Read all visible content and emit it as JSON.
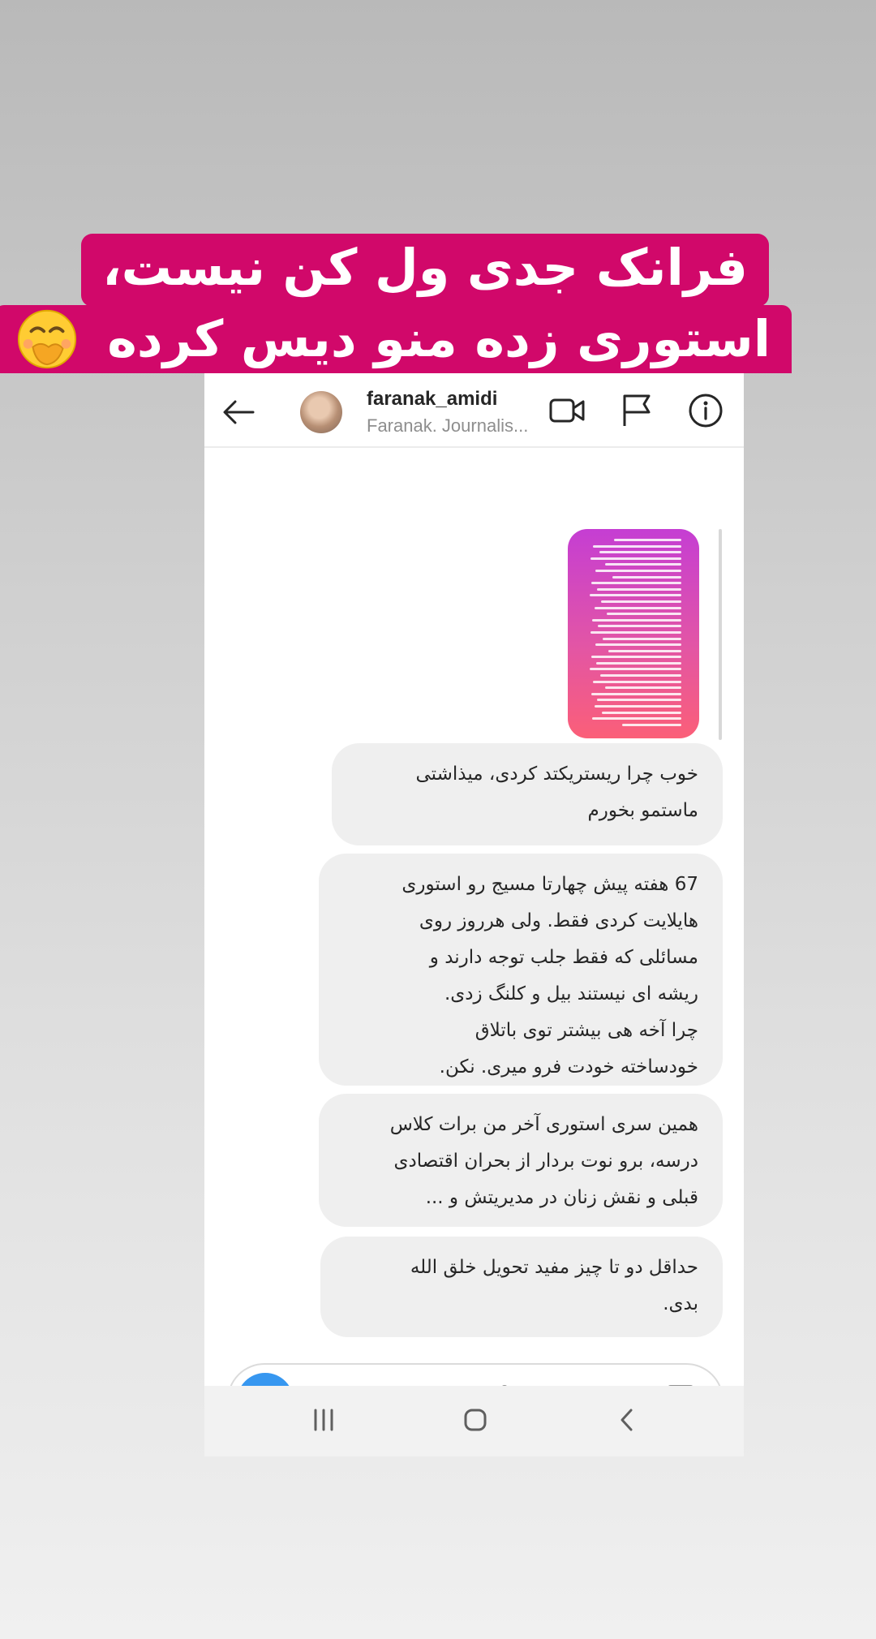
{
  "caption": {
    "line1": "فرانک جدی ول کن نیست،",
    "line2": "استوری زده منو دیس کرده",
    "emoji": "face-with-hand-over-mouth"
  },
  "header": {
    "username": "faranak_amidi",
    "subtitle": "Faranak. Journalis..."
  },
  "messages": [
    {
      "lines": [
        "خوب چرا ریستریکتد کردی، میذاشتی",
        "ماستمو بخورم"
      ]
    },
    {
      "lines": [
        "67 هفته پیش چهارتا مسیج رو استوری",
        "هایلایت کردی فقط. ولی هرروز روی",
        "مسائلی که فقط جلب توجه دارند و",
        "ریشه ای نیستند بیل و کلنگ زدی.",
        "چرا آخه هی بیشتر توی باتلاق",
        "خودساخته خودت فرو میری. نکن."
      ]
    },
    {
      "lines": [
        "همین سری استوری آخر من برات کلاس",
        "درسه، برو نوت بردار از بحران اقتصادی",
        "قبلی و نقش زنان در مدیریتش و ..."
      ]
    },
    {
      "lines": [
        "حداقل دو تا چیز مفید تحویل خلق الله",
        "بدی."
      ]
    }
  ],
  "composer": {
    "placeholder": "Message..."
  },
  "colors": {
    "caption_bg": "#d1086a",
    "bubble_bg": "#efefef",
    "camera_btn": "#3797f0"
  },
  "icons": [
    "back-arrow-icon",
    "video-call-icon",
    "flag-icon",
    "info-icon",
    "camera-icon",
    "microphone-icon",
    "gallery-icon",
    "chat-bubble-icon",
    "sticker-icon",
    "recents-icon",
    "home-icon",
    "nav-back-icon"
  ]
}
